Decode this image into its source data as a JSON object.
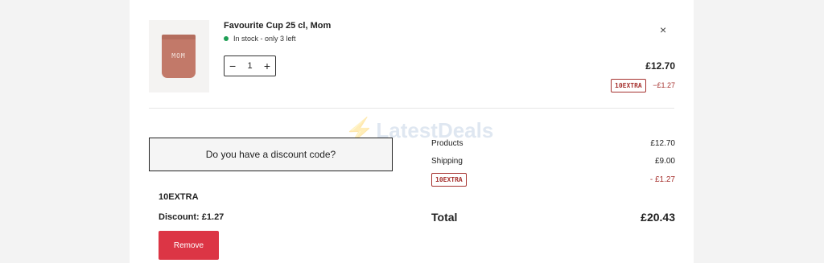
{
  "item": {
    "thumbnail_text": "MOM",
    "title": "Favourite Cup 25 cl, Mom",
    "stock_text": "In stock - only 3 left",
    "quantity": "1",
    "minus_label": "−",
    "plus_label": "+",
    "close_label": "×",
    "price": "£12.70",
    "discount_code": "10EXTRA",
    "discount_amount": "−£1.27"
  },
  "watermark": {
    "text": "LatestDeals",
    "bolt": "⚡"
  },
  "discount": {
    "prompt": "Do you have a discount code?",
    "applied_code": "10EXTRA",
    "applied_discount": "Discount: £1.27",
    "remove_label": "Remove"
  },
  "summary": {
    "products_label": "Products",
    "products_value": "£12.70",
    "shipping_label": "Shipping",
    "shipping_value": "£9.00",
    "code_badge": "10EXTRA",
    "code_value": "- £1.27",
    "total_label": "Total",
    "total_value": "£20.43"
  },
  "colors": {
    "remove_button": "#dc3545",
    "discount_red": "#a6322f",
    "stock_green": "#1e9e54",
    "cup": "#c27969"
  }
}
